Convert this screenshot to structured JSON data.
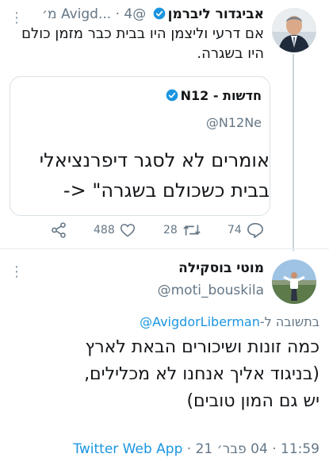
{
  "tweet1": {
    "author_name": "אביגדור ליברמן",
    "handle": "@Avigd...",
    "time": "4 מ׳",
    "text": "אם דרעי וליצמן היו בבית כבר מזמן כולם היו בשגרה.",
    "quoted": {
      "author_name": "חדשות - N12",
      "handle": "@N12Ne",
      "text_line1": "אומרים לא לסגר דיפרנציאלי",
      "text_line2": "בבית כשכולם בשגרה\" <-"
    },
    "stats": {
      "replies": "74",
      "retweets": "28",
      "likes": "488"
    }
  },
  "tweet2": {
    "author_name": "מוטי בוסקילה",
    "handle": "@moti_bouskila",
    "reply_prefix": "בתשובה ל-",
    "reply_mention": "@AvigdorLiberman",
    "text_line1": "כמה זונות ושיכורים הבאת לארץ",
    "text_line2": "(בניגוד אליך אנחנו לא מכלילים,",
    "text_line3": "יש גם המון טובים)",
    "time": "11:59",
    "date": "04 פבר׳ 21",
    "source_app": "Twitter Web App",
    "separator": "·"
  },
  "colors": {
    "accent": "#1b95e0",
    "secondary_text": "#657786",
    "primary_text": "#14171a",
    "divider": "#e6ecf0"
  }
}
